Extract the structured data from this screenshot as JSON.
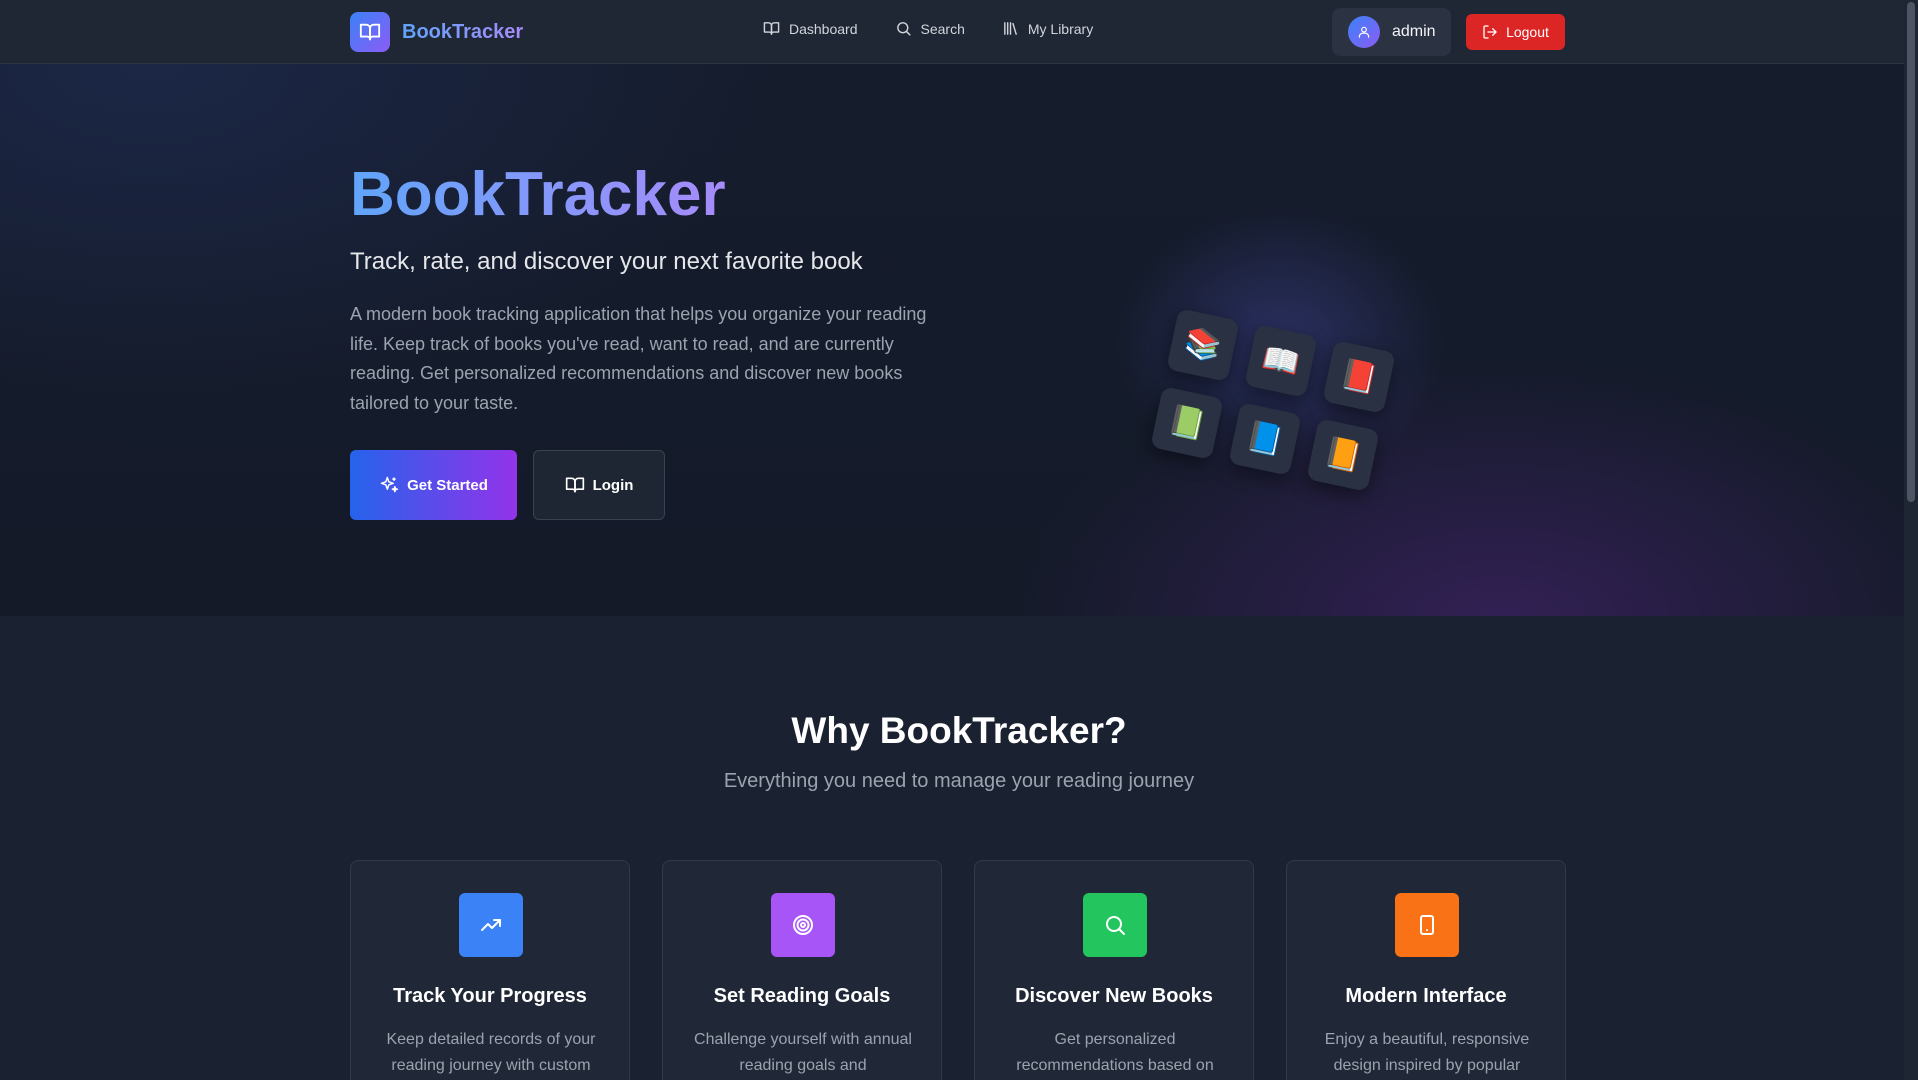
{
  "header": {
    "brand_name": "BookTracker",
    "nav": [
      {
        "label": "Dashboard",
        "icon": "book-open-icon"
      },
      {
        "label": "Search",
        "icon": "search-icon"
      },
      {
        "label": "My Library",
        "icon": "library-icon"
      }
    ],
    "user": {
      "name": "admin",
      "icon": "user-icon"
    },
    "logout_label": "Logout"
  },
  "hero": {
    "title": "BookTracker",
    "subtitle": "Track, rate, and discover your next favorite book",
    "description": "A modern book tracking application that helps you organize your reading life. Keep track of books you've read, want to read, and are currently reading. Get personalized recommendations and discover new books tailored to your taste.",
    "primary_button": "Get Started",
    "secondary_button": "Login",
    "illustration_emoji": [
      "📚",
      "📖",
      "📕",
      "📗",
      "📘",
      "📙"
    ]
  },
  "features": {
    "title": "Why BookTracker?",
    "subtitle": "Everything you need to manage your reading journey",
    "cards": [
      {
        "title": "Track Your Progress",
        "description": "Keep detailed records of your reading journey with custom",
        "icon": "trending-up-icon",
        "color": "#3b82f6"
      },
      {
        "title": "Set Reading Goals",
        "description": "Challenge yourself with annual reading goals and",
        "icon": "target-icon",
        "color": "#a855f7"
      },
      {
        "title": "Discover New Books",
        "description": "Get personalized recommendations based on",
        "icon": "search-icon",
        "color": "#22c55e"
      },
      {
        "title": "Modern Interface",
        "description": "Enjoy a beautiful, responsive design inspired by popular",
        "icon": "tablet-icon",
        "color": "#f97316"
      }
    ]
  },
  "colors": {
    "accent_blue": "#3b82f6",
    "accent_purple": "#8b5cf6",
    "logout_red": "#dc2626",
    "background": "#1a2130"
  }
}
